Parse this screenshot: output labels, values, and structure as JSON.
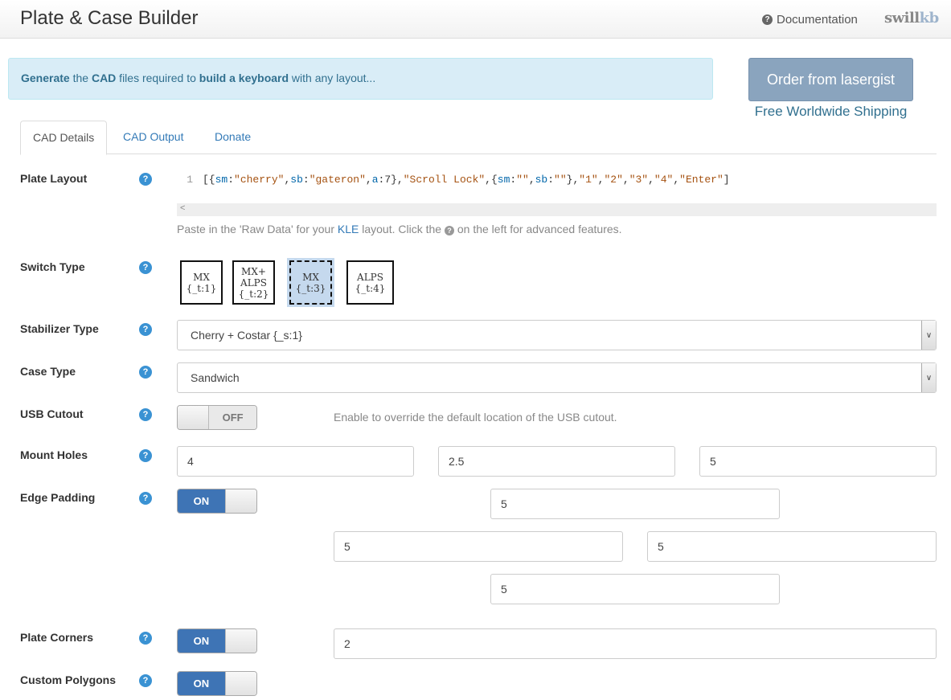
{
  "header": {
    "title": "Plate & Case Builder",
    "documentation_label": "Documentation",
    "brand_part1": "swill",
    "brand_part2": "kb"
  },
  "banner": {
    "w1": "Generate",
    "w2": " the ",
    "w3": "CAD",
    "w4": " files required to ",
    "w5": "build a keyboard",
    "w6": " with any layout..."
  },
  "order": {
    "button_label": "Order from lasergist",
    "shipping_text": "Free Worldwide Shipping"
  },
  "tabs": [
    {
      "label": "CAD Details",
      "active": true
    },
    {
      "label": "CAD Output",
      "active": false
    },
    {
      "label": "Donate",
      "active": false
    }
  ],
  "form": {
    "plate_layout": {
      "label": "Plate Layout",
      "line_number": "1",
      "code_tokens": [
        {
          "t": "[{",
          "c": "punc"
        },
        {
          "t": "sm",
          "c": "key"
        },
        {
          "t": ":",
          "c": "punc"
        },
        {
          "t": "\"cherry\"",
          "c": "str"
        },
        {
          "t": ",",
          "c": "punc"
        },
        {
          "t": "sb",
          "c": "key"
        },
        {
          "t": ":",
          "c": "punc"
        },
        {
          "t": "\"gateron\"",
          "c": "str"
        },
        {
          "t": ",",
          "c": "punc"
        },
        {
          "t": "a",
          "c": "key"
        },
        {
          "t": ":7},",
          "c": "punc"
        },
        {
          "t": "\"Scroll Lock\"",
          "c": "str"
        },
        {
          "t": ",{",
          "c": "punc"
        },
        {
          "t": "sm",
          "c": "key"
        },
        {
          "t": ":",
          "c": "punc"
        },
        {
          "t": "\"\"",
          "c": "str"
        },
        {
          "t": ",",
          "c": "punc"
        },
        {
          "t": "sb",
          "c": "key"
        },
        {
          "t": ":",
          "c": "punc"
        },
        {
          "t": "\"\"",
          "c": "str"
        },
        {
          "t": "},",
          "c": "punc"
        },
        {
          "t": "\"1\"",
          "c": "str"
        },
        {
          "t": ",",
          "c": "punc"
        },
        {
          "t": "\"2\"",
          "c": "str"
        },
        {
          "t": ",",
          "c": "punc"
        },
        {
          "t": "\"3\"",
          "c": "str"
        },
        {
          "t": ",",
          "c": "punc"
        },
        {
          "t": "\"4\"",
          "c": "str"
        },
        {
          "t": ",",
          "c": "punc"
        },
        {
          "t": "\"Enter\"",
          "c": "str"
        },
        {
          "t": "]",
          "c": "punc"
        }
      ],
      "hint_pre": "Paste in the 'Raw Data' for your ",
      "hint_link": "KLE",
      "hint_mid": " layout. Click the ",
      "hint_post": " on the left for advanced features."
    },
    "switch_type": {
      "label": "Switch Type",
      "options": [
        {
          "line1": "MX",
          "line2": "{_t:1}",
          "line3": "",
          "selected": false
        },
        {
          "line1": "MX+",
          "line2": "ALPS",
          "line3": "{_t:2}",
          "selected": false
        },
        {
          "line1": "MX",
          "line2": "{_t:3}",
          "line3": "",
          "selected": true
        },
        {
          "line1": "ALPS",
          "line2": "{_t:4}",
          "line3": "",
          "selected": false
        }
      ]
    },
    "stabilizer_type": {
      "label": "Stabilizer Type",
      "value": "Cherry + Costar {_s:1}"
    },
    "case_type": {
      "label": "Case Type",
      "value": "Sandwich"
    },
    "usb_cutout": {
      "label": "USB Cutout",
      "toggle": "OFF",
      "hint": "Enable to override the default location of the USB cutout."
    },
    "mount_holes": {
      "label": "Mount Holes",
      "values": [
        "4",
        "2.5",
        "5"
      ]
    },
    "edge_padding": {
      "label": "Edge Padding",
      "toggle": "ON",
      "top": "5",
      "left": "5",
      "right": "5",
      "bottom": "5"
    },
    "plate_corners": {
      "label": "Plate Corners",
      "toggle": "ON",
      "value": "2"
    },
    "custom_polygons": {
      "label": "Custom Polygons",
      "toggle": "ON"
    }
  },
  "colors": {
    "accent": "#337ab7",
    "help_icon": "#3a92d3",
    "toggle_on": "#3e74b5",
    "banner_bg": "#d9edf7",
    "order_button": "#8aa4be"
  }
}
